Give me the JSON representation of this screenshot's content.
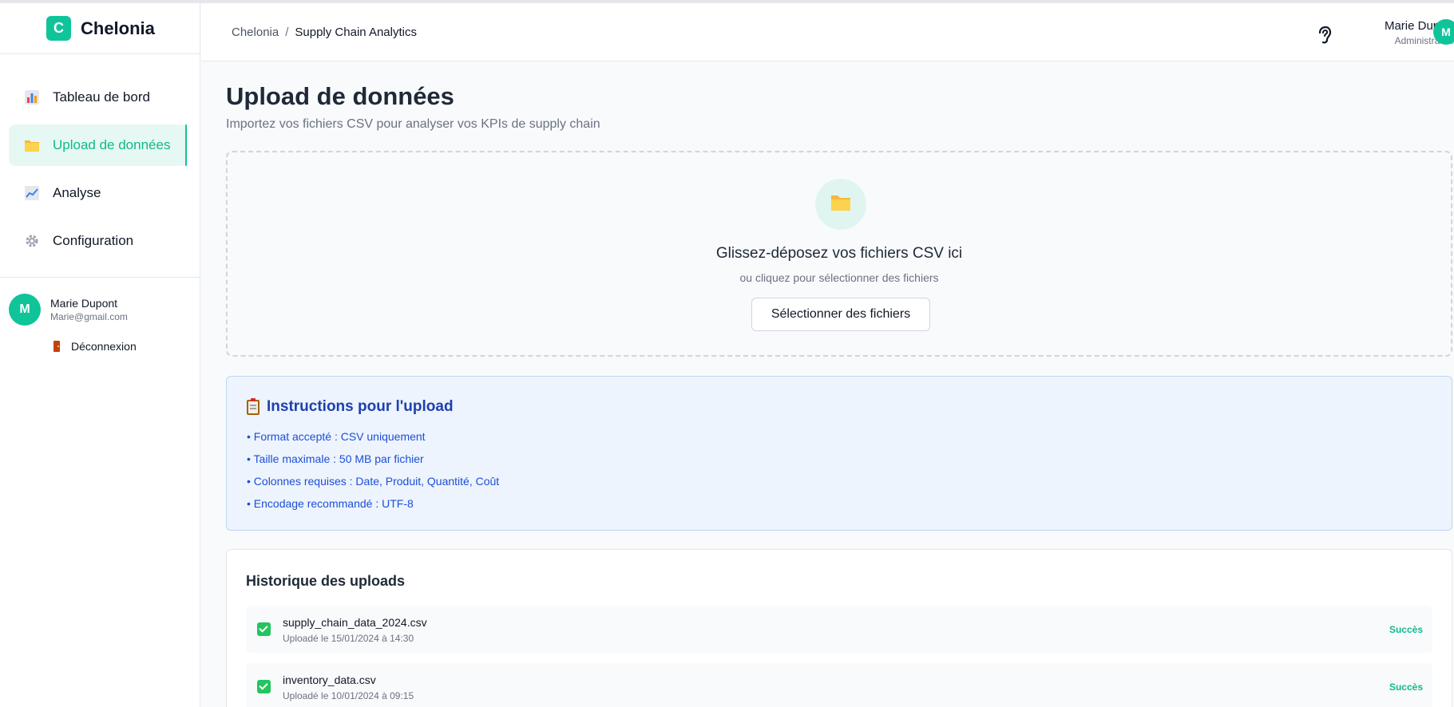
{
  "brand": {
    "logo_letter": "C",
    "name": "Chelonia"
  },
  "sidebar": {
    "items": [
      {
        "label": "Tableau de bord",
        "icon": "bar-chart-icon"
      },
      {
        "label": "Upload de données",
        "icon": "folder-icon",
        "active": true
      },
      {
        "label": "Analyse",
        "icon": "line-chart-icon"
      },
      {
        "label": "Configuration",
        "icon": "gear-icon"
      }
    ],
    "user": {
      "initial": "M",
      "name": "Marie Dupont",
      "email": "Marie@gmail.com"
    },
    "logout_label": "Déconnexion"
  },
  "header": {
    "breadcrumb": {
      "root": "Chelonia",
      "separator": "/",
      "current": "Supply Chain Analytics"
    },
    "icon": "ear-icon",
    "user": {
      "name": "Marie Dupont",
      "role": "Administrateur",
      "initial": "M"
    }
  },
  "page": {
    "title": "Upload de données",
    "subtitle": "Importez vos fichiers CSV pour analyser vos KPIs de supply chain"
  },
  "dropzone": {
    "icon": "folder-icon",
    "title": "Glissez-déposez vos fichiers CSV ici",
    "subtitle": "ou cliquez pour sélectionner des fichiers",
    "button_label": "Sélectionner des fichiers"
  },
  "instructions": {
    "title": "Instructions pour l'upload",
    "icon": "clipboard-icon",
    "items": [
      "• Format accepté : CSV uniquement",
      "• Taille maximale : 50 MB par fichier",
      "• Colonnes requises : Date, Produit, Quantité, Coût",
      "• Encodage recommandé : UTF-8"
    ]
  },
  "history": {
    "title": "Historique des uploads",
    "items": [
      {
        "file": "supply_chain_data_2024.csv",
        "date": "Uploadé le 15/01/2024 à 14:30",
        "status": "Succès"
      },
      {
        "file": "inventory_data.csv",
        "date": "Uploadé le 10/01/2024 à 09:15",
        "status": "Succès"
      }
    ]
  },
  "colors": {
    "accent": "#10c49a",
    "info": "#1e40af",
    "info_bg": "#edf4fd",
    "success": "#22c55e"
  }
}
